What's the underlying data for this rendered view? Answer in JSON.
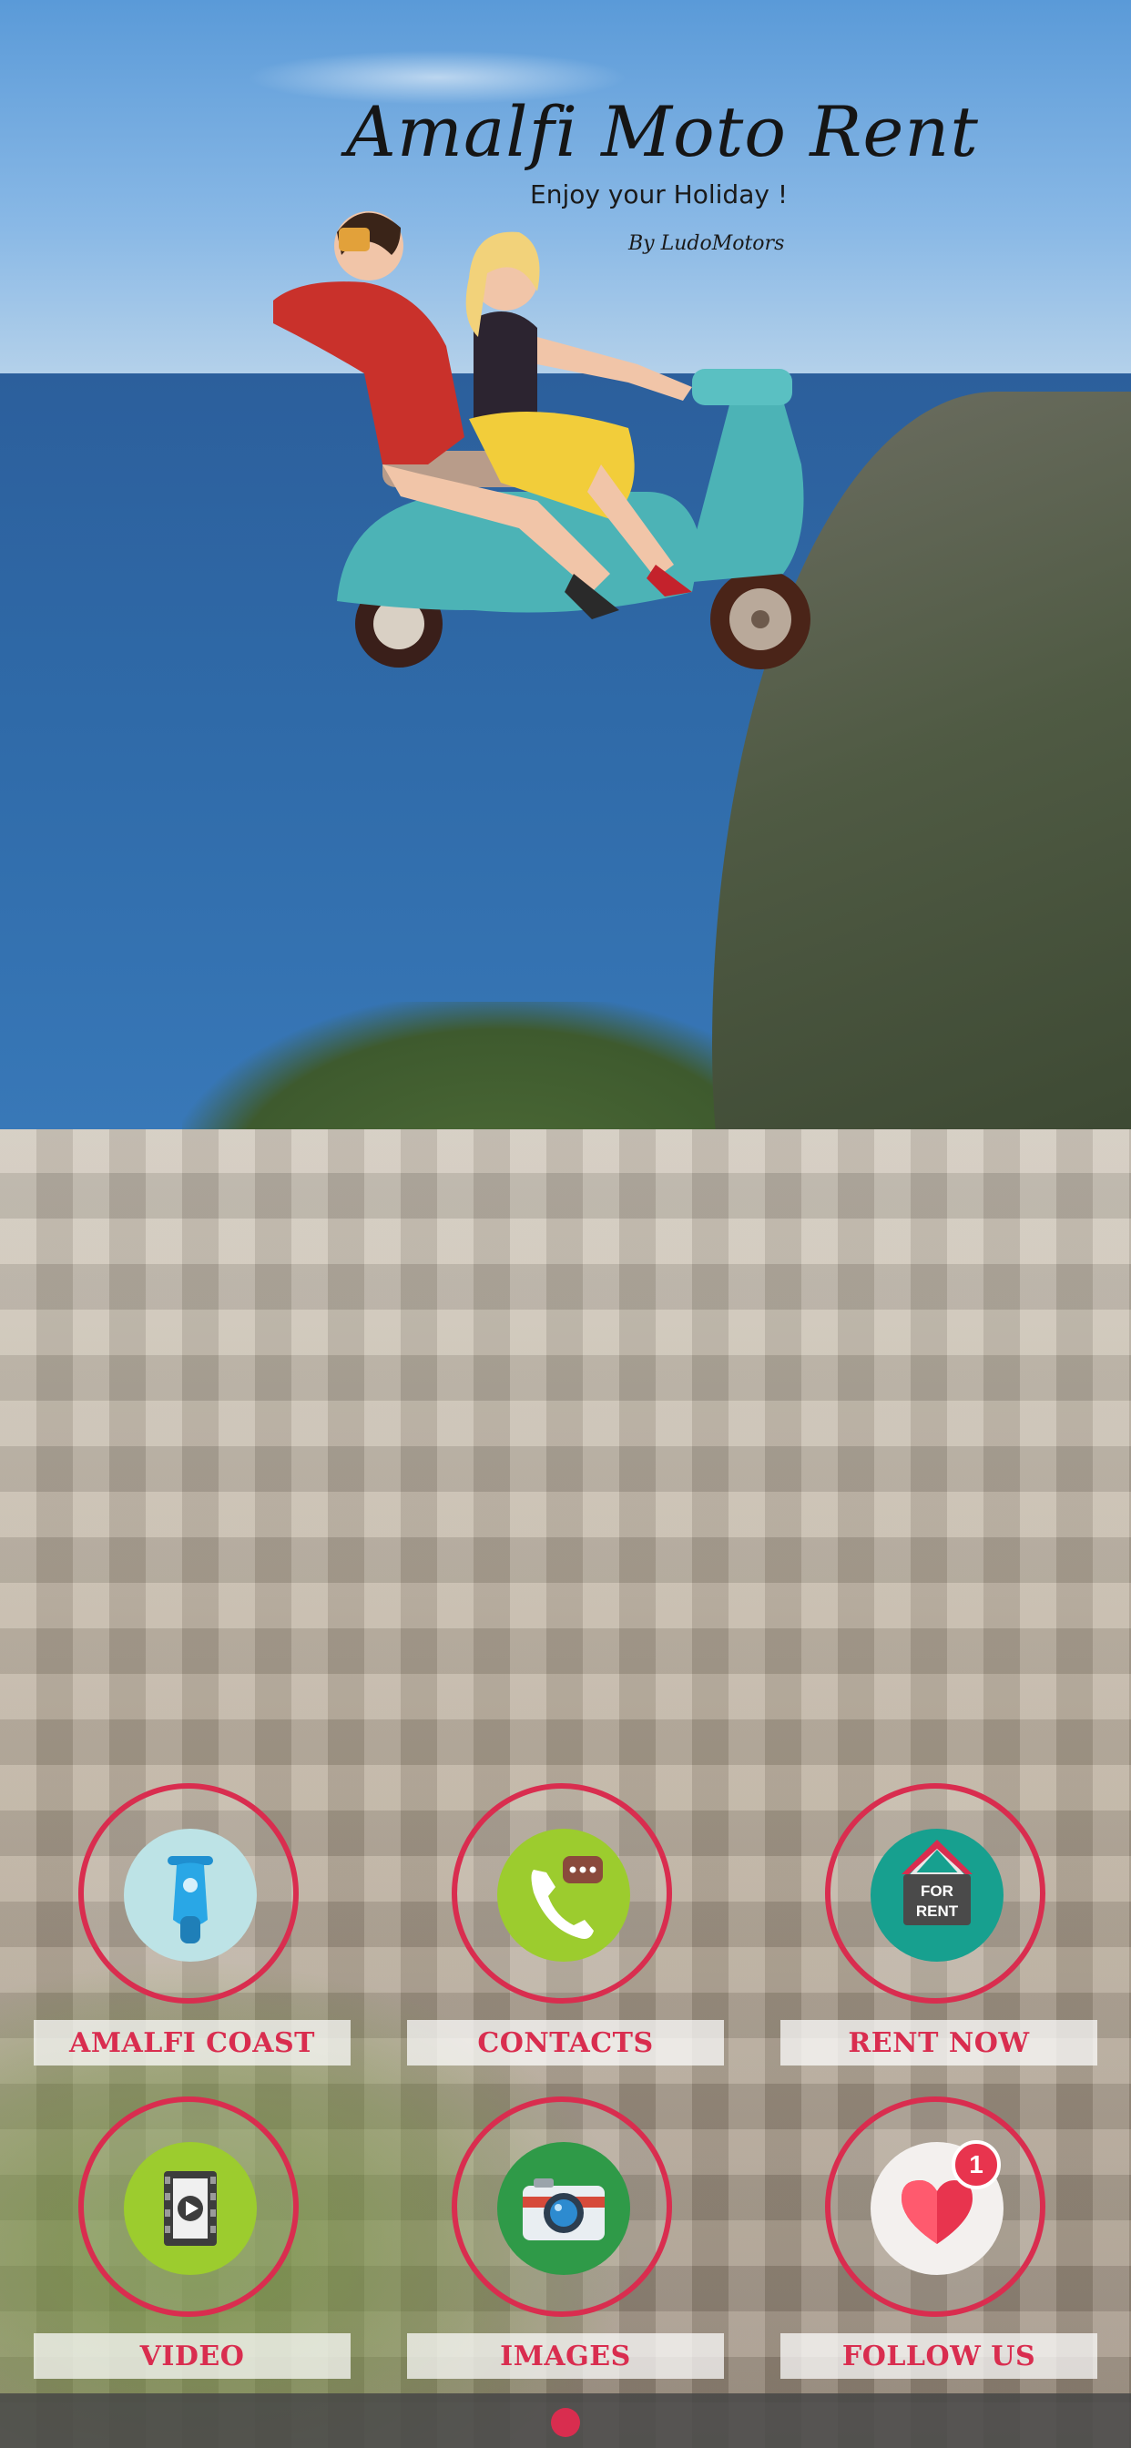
{
  "logo": {
    "title": "Amalfi Moto Rent",
    "tagline": "Enjoy your Holiday !",
    "byline": "By LudoMotors"
  },
  "menu": [
    {
      "label": "AMALFI COAST",
      "icon": "scooter-icon"
    },
    {
      "label": "CONTACTS",
      "icon": "phone-icon"
    },
    {
      "label": "RENT NOW",
      "icon": "for-rent-sign-icon",
      "icon_text_1": "FOR",
      "icon_text_2": "RENT"
    },
    {
      "label": "VIDEO",
      "icon": "video-icon"
    },
    {
      "label": "IMAGES",
      "icon": "camera-icon"
    },
    {
      "label": "FOLLOW US",
      "icon": "heart-icon",
      "badge": "1"
    }
  ],
  "colors": {
    "accent": "#d92d4f",
    "label_background": "#ffffff"
  },
  "pagination": {
    "pages": 1,
    "current": 1
  }
}
